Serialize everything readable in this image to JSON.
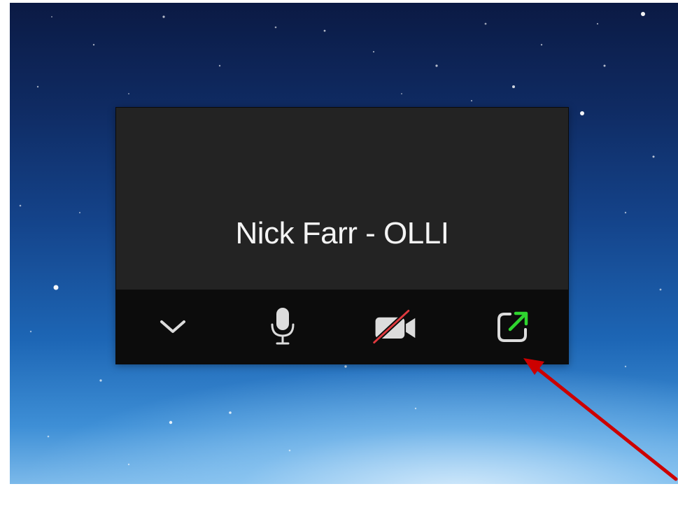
{
  "participant": {
    "name": "Nick Farr - OLLI"
  },
  "controls": [
    {
      "id": "collapse",
      "icon": "chevron-down-icon"
    },
    {
      "id": "microphone",
      "icon": "microphone-icon"
    },
    {
      "id": "video",
      "icon": "video-off-icon",
      "state": "off"
    },
    {
      "id": "exit-minimized",
      "icon": "external-window-icon"
    }
  ],
  "colors": {
    "window_bg": "#232323",
    "control_bar_bg": "#0c0c0c",
    "icon_color": "#dcdcdc",
    "video_off_slash": "#e0393e",
    "external_arrow": "#2fd52f",
    "annotation_arrow": "#cc0000"
  }
}
